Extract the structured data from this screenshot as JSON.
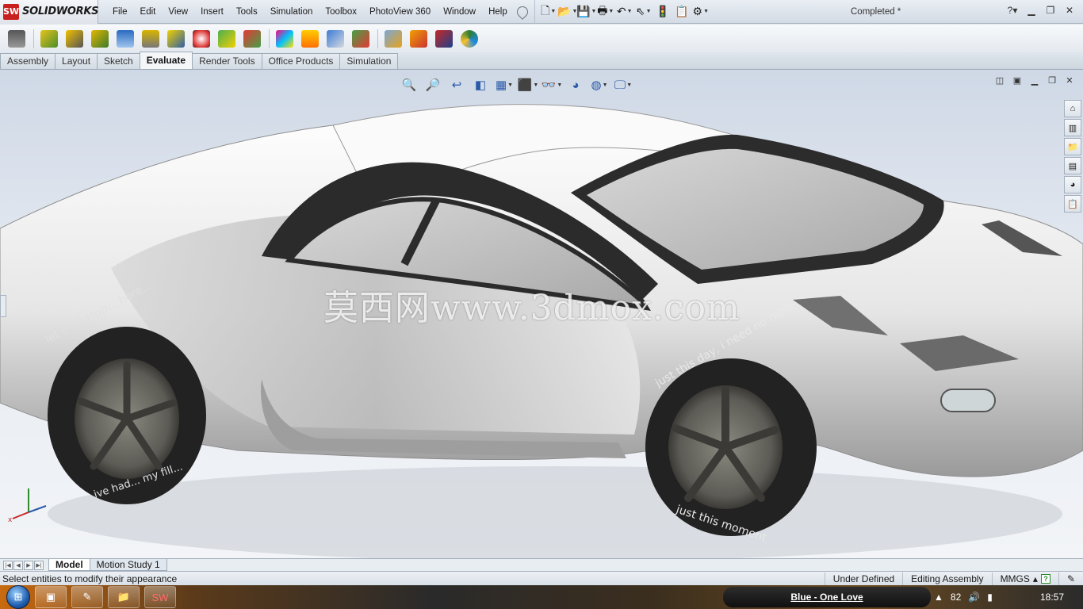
{
  "app": {
    "logo_mark": "SW",
    "logo_text": "SOLIDWORKS",
    "document_title": "Completed *"
  },
  "menu": {
    "items": [
      "File",
      "Edit",
      "View",
      "Insert",
      "Tools",
      "Simulation",
      "Toolbox",
      "PhotoView 360",
      "Window",
      "Help"
    ]
  },
  "command_tabs": {
    "items": [
      "Assembly",
      "Layout",
      "Sketch",
      "Evaluate",
      "Render Tools",
      "Office Products",
      "Simulation"
    ],
    "active": "Evaluate"
  },
  "viewport": {
    "watermark": "莫西网www.3dmox.com",
    "tire_text_rear_top": "let it all stop... here...",
    "tire_text_rear_bottom": "ive had... my fill...",
    "tire_text_front_top": "just this day, i need no more",
    "tire_text_front_bottom": "just this moment"
  },
  "bottom_tabs": {
    "items": [
      "Model",
      "Motion Study 1"
    ],
    "active": "Model"
  },
  "status": {
    "message": "Select entities to modify their appearance",
    "definition": "Under Defined",
    "mode": "Editing Assembly",
    "units": "MMGS"
  },
  "taskbar": {
    "now_playing": "Blue - One Love",
    "tray_number": "82",
    "clock": "18:57"
  },
  "colors": {
    "brand": "#c8201f",
    "accent": "#2b5aa8",
    "car_body": "#f2f2f2"
  }
}
